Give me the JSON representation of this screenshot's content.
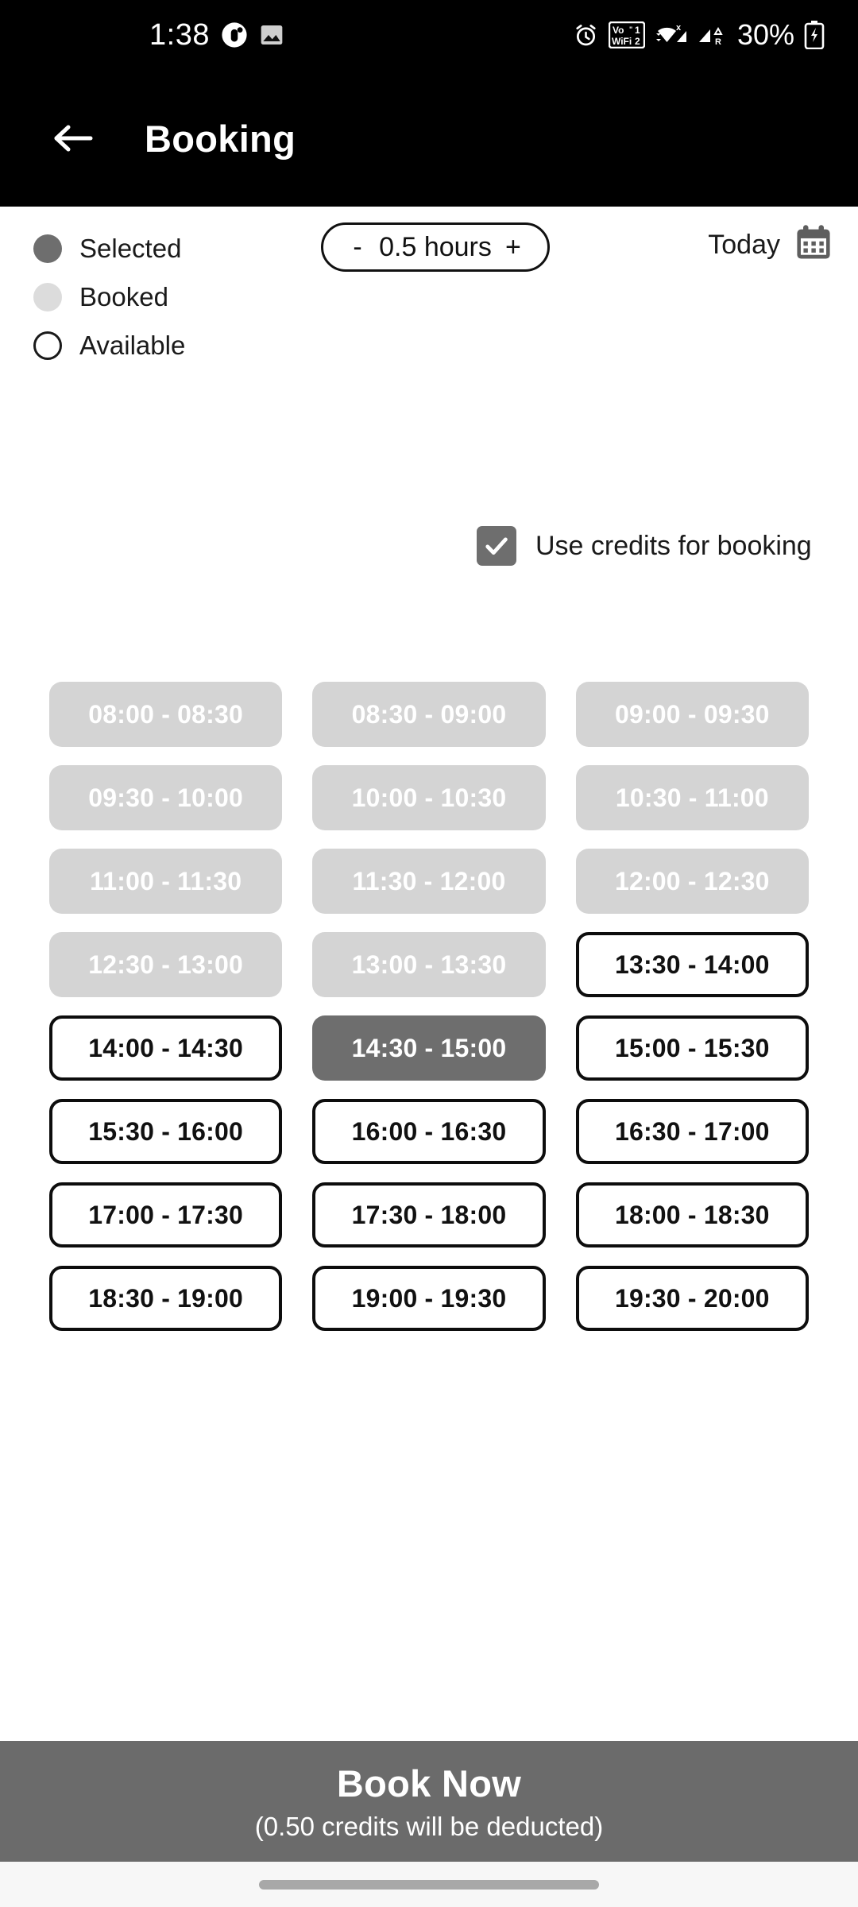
{
  "status_bar": {
    "time": "1:38",
    "battery_percent": "30%",
    "icons": [
      "app-notification-icon",
      "image-icon",
      "alarm-icon",
      "volte-wifi-calling-icon",
      "wifi-icon",
      "signal-sim1-icon",
      "signal-sim2-roaming-icon",
      "battery-charging-icon"
    ]
  },
  "app_bar": {
    "back_icon": "arrow-back-icon",
    "title": "Booking"
  },
  "legend": {
    "items": [
      {
        "label": "Selected",
        "state": "selected",
        "color": "#6e6e6e"
      },
      {
        "label": "Booked",
        "state": "booked",
        "color": "#dcdcdc"
      },
      {
        "label": "Available",
        "state": "available",
        "color": "#ffffff"
      }
    ]
  },
  "duration": {
    "decrement_label": "-",
    "value": "0.5 hours",
    "increment_label": "+"
  },
  "date_selector": {
    "label": "Today",
    "icon": "calendar-icon"
  },
  "credits_option": {
    "label": "Use credits for booking",
    "checked": true,
    "check_icon": "check-icon"
  },
  "slots": [
    {
      "label": "08:00 - 08:30",
      "state": "booked"
    },
    {
      "label": "08:30 - 09:00",
      "state": "booked"
    },
    {
      "label": "09:00 - 09:30",
      "state": "booked"
    },
    {
      "label": "09:30 - 10:00",
      "state": "booked"
    },
    {
      "label": "10:00 - 10:30",
      "state": "booked"
    },
    {
      "label": "10:30 - 11:00",
      "state": "booked"
    },
    {
      "label": "11:00 - 11:30",
      "state": "booked"
    },
    {
      "label": "11:30 - 12:00",
      "state": "booked"
    },
    {
      "label": "12:00 - 12:30",
      "state": "booked"
    },
    {
      "label": "12:30 - 13:00",
      "state": "booked"
    },
    {
      "label": "13:00 - 13:30",
      "state": "booked"
    },
    {
      "label": "13:30 - 14:00",
      "state": "available"
    },
    {
      "label": "14:00 - 14:30",
      "state": "available"
    },
    {
      "label": "14:30 - 15:00",
      "state": "selected"
    },
    {
      "label": "15:00 - 15:30",
      "state": "available"
    },
    {
      "label": "15:30 - 16:00",
      "state": "available"
    },
    {
      "label": "16:00 - 16:30",
      "state": "available"
    },
    {
      "label": "16:30 - 17:00",
      "state": "available"
    },
    {
      "label": "17:00 - 17:30",
      "state": "available"
    },
    {
      "label": "17:30 - 18:00",
      "state": "available"
    },
    {
      "label": "18:00 - 18:30",
      "state": "available"
    },
    {
      "label": "18:30 - 19:00",
      "state": "available"
    },
    {
      "label": "19:00 - 19:30",
      "state": "available"
    },
    {
      "label": "19:30 - 20:00",
      "state": "available"
    }
  ],
  "book_bar": {
    "title": "Book Now",
    "subtitle": "(0.50 credits will be deducted)"
  },
  "colors": {
    "booked_bg": "#d4d4d4",
    "selected_bg": "#6e6e6e",
    "available_border": "#0d0d0d",
    "book_bar_bg": "#6b6b6b",
    "appbar_bg": "#000000"
  }
}
